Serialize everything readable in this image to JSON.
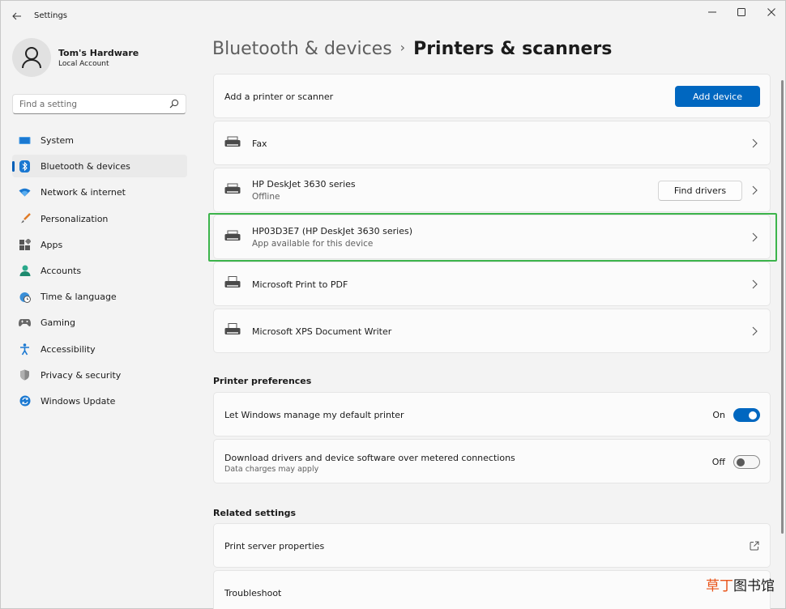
{
  "window": {
    "title": "Settings"
  },
  "profile": {
    "name": "Tom's Hardware",
    "account_type": "Local Account"
  },
  "search": {
    "placeholder": "Find a setting"
  },
  "nav": {
    "items": [
      {
        "label": "System",
        "icon": "system-icon"
      },
      {
        "label": "Bluetooth & devices",
        "icon": "bluetooth-icon",
        "active": true
      },
      {
        "label": "Network & internet",
        "icon": "wifi-icon"
      },
      {
        "label": "Personalization",
        "icon": "brush-icon"
      },
      {
        "label": "Apps",
        "icon": "apps-icon"
      },
      {
        "label": "Accounts",
        "icon": "person-icon"
      },
      {
        "label": "Time & language",
        "icon": "globe-clock-icon"
      },
      {
        "label": "Gaming",
        "icon": "gamepad-icon"
      },
      {
        "label": "Accessibility",
        "icon": "accessibility-icon"
      },
      {
        "label": "Privacy & security",
        "icon": "shield-icon"
      },
      {
        "label": "Windows Update",
        "icon": "update-icon"
      }
    ]
  },
  "breadcrumb": {
    "parent": "Bluetooth & devices",
    "separator": "›",
    "current": "Printers & scanners"
  },
  "add_printer": {
    "label": "Add a printer or scanner",
    "button": "Add device"
  },
  "printers": [
    {
      "name": "Fax",
      "status": ""
    },
    {
      "name": "HP DeskJet 3630 series",
      "status": "Offline",
      "button": "Find drivers"
    },
    {
      "name": "HP03D3E7 (HP DeskJet 3630 series)",
      "status": "App available for this device"
    },
    {
      "name": "Microsoft Print to PDF",
      "status": ""
    },
    {
      "name": "Microsoft XPS Document Writer",
      "status": ""
    }
  ],
  "preferences": {
    "title": "Printer preferences",
    "items": [
      {
        "label": "Let Windows manage my default printer",
        "sub": "",
        "state": "On",
        "on": true
      },
      {
        "label": "Download drivers and device software over metered connections",
        "sub": "Data charges may apply",
        "state": "Off",
        "on": false
      }
    ]
  },
  "related": {
    "title": "Related settings",
    "items": [
      {
        "label": "Print server properties"
      },
      {
        "label": "Troubleshoot"
      }
    ]
  },
  "watermark": {
    "accent": "草丁",
    "rest": "图书馆"
  },
  "colors": {
    "accent": "#0067c0",
    "highlight": "#3cb44b",
    "background": "#f3f3f3",
    "card": "#fbfbfb"
  }
}
